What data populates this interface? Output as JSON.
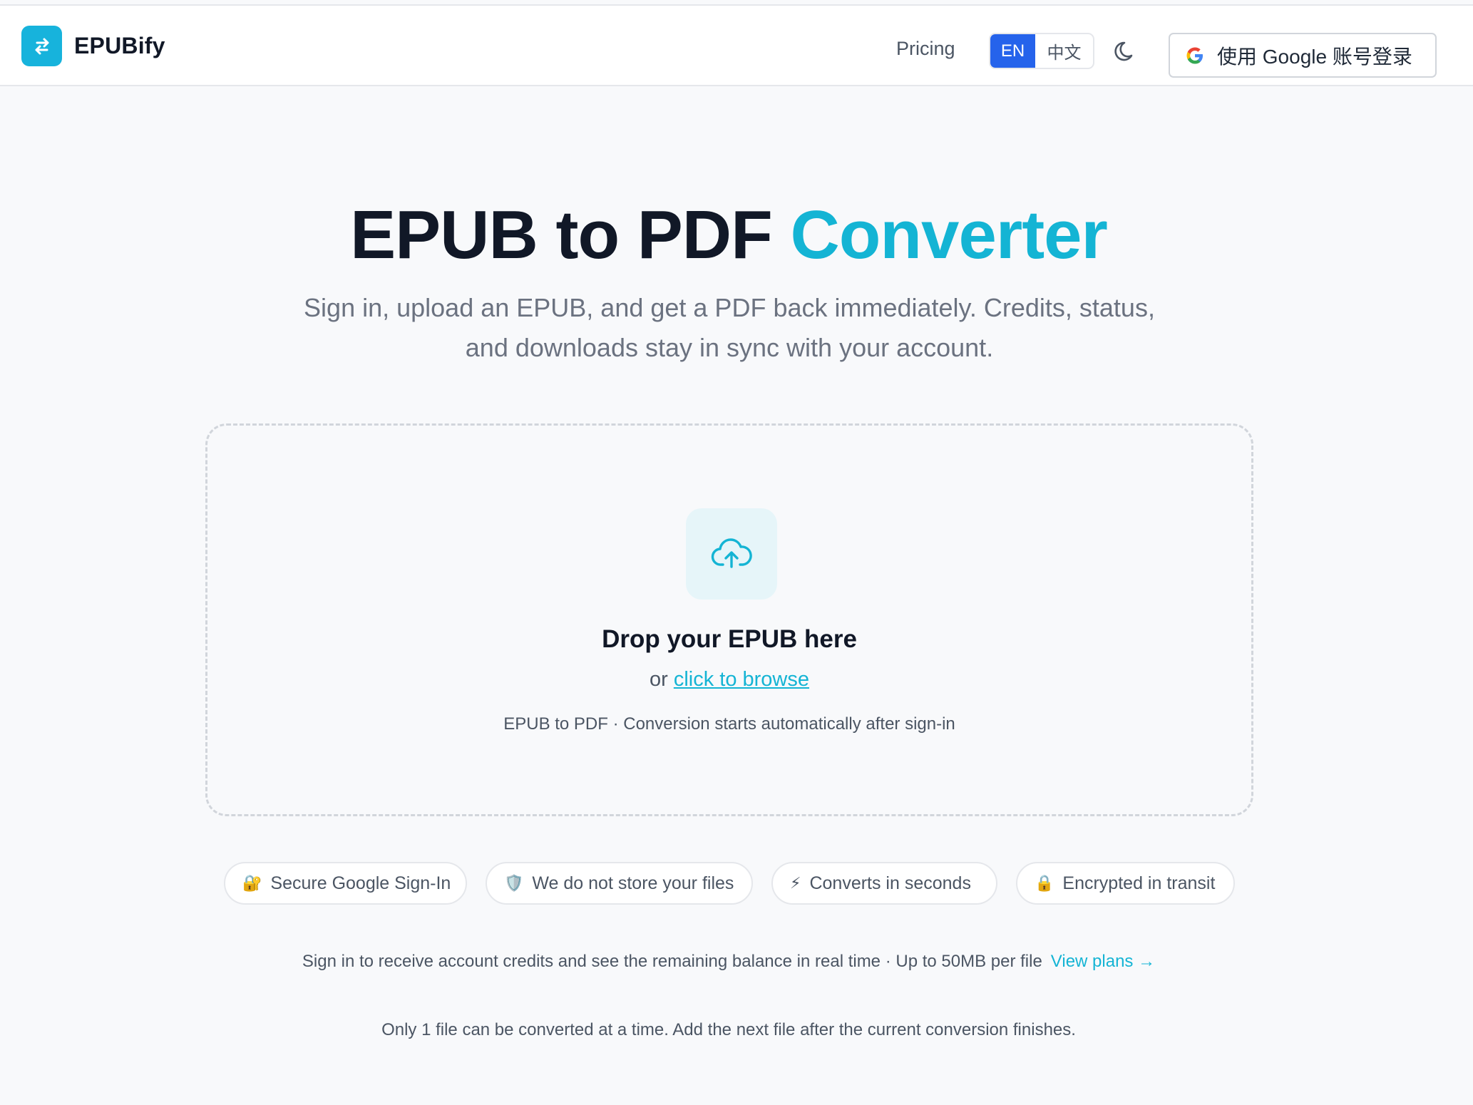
{
  "brand": {
    "name": "EPUBify",
    "logo_icon": "swap-arrows-icon",
    "accent": "#17b3dc"
  },
  "nav": {
    "pricing": "Pricing",
    "lang_en": "EN",
    "lang_zh": "中文",
    "theme_icon": "moon-icon",
    "signin_label": "使用 Google 账号登录"
  },
  "hero": {
    "title_main": "EPUB to PDF ",
    "title_accent": "Converter",
    "subtitle": "Sign in, upload an EPUB, and get a PDF back immediately. Credits, status, and downloads stay in sync with your account."
  },
  "dropzone": {
    "icon": "cloud-upload-icon",
    "title": "Drop your EPUB here",
    "or": "or ",
    "browse": "click to browse",
    "hint": "EPUB to PDF · Conversion starts automatically after sign-in"
  },
  "features": [
    {
      "icon": "🔐",
      "label": "Secure Google Sign-In"
    },
    {
      "icon": "🛡️",
      "label": "We do not store your files"
    },
    {
      "icon": "⚡",
      "label": "Converts in seconds"
    },
    {
      "icon": "🔒",
      "label": "Encrypted in transit"
    }
  ],
  "footer": {
    "credits_text": "Sign in to receive account credits and see the remaining balance in real time · Up to 50MB per file",
    "view_plans": "View plans →",
    "limit_text": "Only 1 file can be converted at a time. Add the next file after the current conversion finishes."
  },
  "colors": {
    "primary_blue": "#2563eb",
    "accent_cyan": "#14b4d4",
    "text_dark": "#111827",
    "text_muted": "#6b7280"
  }
}
